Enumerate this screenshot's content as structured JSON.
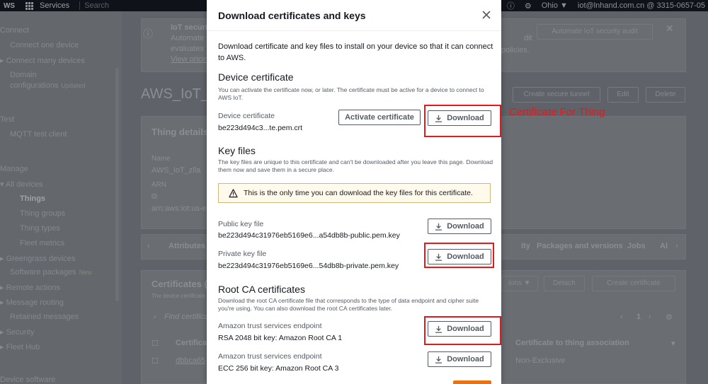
{
  "topnav": {
    "logo": "WS",
    "services": "Services",
    "search_placeholder": "Search",
    "region": "Ohio ▼",
    "account": "iot@lnhand.com.cn @ 3315-0657-05"
  },
  "sidebar": {
    "connect": "Connect",
    "connect_one": "Connect one device",
    "connect_many": "Connect many devices",
    "domain": "Domain",
    "domain_config": "configurations",
    "updated_badge": "Updated",
    "test": "Test",
    "mqtt": "MQTT test client",
    "manage": "Manage",
    "all_devices": "All devices",
    "things": "Things",
    "thing_groups": "Thing groups",
    "thing_types": "Thing types",
    "fleet_metrics": "Fleet metrics",
    "greengrass": "Greengrass devices",
    "software_packages": "Software packages",
    "new_badge": "New",
    "remote_actions": "Remote actions",
    "message_routing": "Message routing",
    "retained": "Retained messages",
    "security": "Security",
    "fleet_hub": "Fleet Hub",
    "device_software": "Device software"
  },
  "background": {
    "banner_title": "IoT security",
    "banner_line1": "Automate y",
    "banner_line2": "evaluates yo",
    "banner_link": "View pricing",
    "banner_right1": "dit",
    "banner_right2": "policies.",
    "automate_btn": "Automate IoT security audit",
    "page_title": "AWS_IoT_z",
    "create_tunnel_btn": "Create secure tunnel",
    "edit_btn": "Edit",
    "delete_btn": "Delete",
    "thing_details": "Thing details",
    "name_label": "Name",
    "name_value": "AWS_IoT_zlla",
    "arn_label": "ARN",
    "arn_value": "arn:aws:iot:us-east",
    "tab_attributes": "Attributes",
    "tab_ity": "ity",
    "tab_packages": "Packages and versions",
    "tab_jobs": "Jobs",
    "tab_al": "Al",
    "certificates_title": "Certificates (1",
    "certificates_desc": "The device certificate",
    "actions_btn": "ions ▼",
    "detach_btn": "Detach",
    "create_cert_btn": "Create certificate",
    "find_placeholder": "Find certificate",
    "page_num": "1",
    "col_certificate": "Certificat",
    "col_association": "Certificate to thing association",
    "row_id": "dbbca65",
    "row_assoc": "Non-Exclusive"
  },
  "modal": {
    "title": "Download certificates and keys",
    "intro": "Download certificate and key files to install on your device so that it can connect to AWS.",
    "device_cert": {
      "title": "Device certificate",
      "desc": "You can activate the certificate now, or later. The certificate must be active for a device to connect to AWS IoT.",
      "label": "Device certificate",
      "value": "be223d494c3...te.pem.crt",
      "activate_label": "Activate certificate",
      "download_label": "Download"
    },
    "key_files": {
      "title": "Key files",
      "desc": "The key files are unique to this certificate and can't be downloaded after you leave this page. Download them now and save them in a secure place.",
      "warning": "This is the only time you can download the key files for this certificate.",
      "public_label": "Public key file",
      "public_value": "be223d494c31976eb5169e6...a54db8b-public.pem.key",
      "private_label": "Private key file",
      "private_value": "be223d494c31976eb5169e6...54db8b-private.pem.key",
      "download_label": "Download"
    },
    "root_ca": {
      "title": "Root CA certificates",
      "desc": "Download the root CA certificate file that corresponds to the type of data endpoint and cipher suite you're using. You can also download the root CA certificates later.",
      "rsa_label": "Amazon trust services endpoint",
      "rsa_value": "RSA 2048 bit key: Amazon Root CA 1",
      "ecc_label": "Amazon trust services endpoint",
      "ecc_value": "ECC 256 bit key: Amazon Root CA 3",
      "download_label": "Download"
    }
  },
  "annotation": {
    "label": "Certificate For Thing",
    "color": "#e3191c"
  },
  "colors": {
    "warning_bg": "#fffaeb",
    "primary": "#ec7211"
  }
}
